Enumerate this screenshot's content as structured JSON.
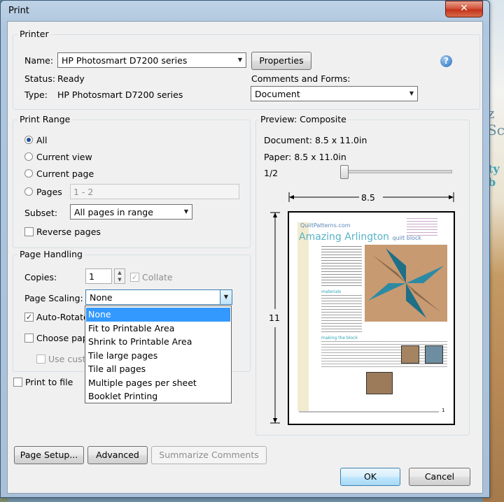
{
  "window": {
    "title": "Print",
    "close_glyph": "✕"
  },
  "printer": {
    "legend": "Printer",
    "name_label": "Name:",
    "name_value": "HP Photosmart D7200 series",
    "status_label": "Status:",
    "status_value": "Ready",
    "type_label": "Type:",
    "type_value": "HP Photosmart D7200 series",
    "properties_button": "Properties",
    "comments_label": "Comments and Forms:",
    "comments_value": "Document",
    "help_glyph": "?"
  },
  "print_range": {
    "legend": "Print Range",
    "options": [
      "All",
      "Current view",
      "Current page",
      "Pages"
    ],
    "selected": "All",
    "pages_value": "1 - 2",
    "subset_label": "Subset:",
    "subset_value": "All pages in range",
    "reverse_label": "Reverse pages",
    "reverse_checked": false
  },
  "page_handling": {
    "legend": "Page Handling",
    "copies_label": "Copies:",
    "copies_value": "1",
    "collate_label": "Collate",
    "collate_checked": true,
    "scaling_label": "Page Scaling:",
    "scaling_value": "None",
    "auto_rotate_label": "Auto-Rotate",
    "auto_rotate_checked": true,
    "choose_paper_label": "Choose pape",
    "use_custom_label": "Use custo",
    "scaling_options": [
      "None",
      "Fit to Printable Area",
      "Shrink to Printable Area",
      "Tile large pages",
      "Tile all pages",
      "Multiple pages per sheet",
      "Booklet Printing"
    ],
    "scaling_selected": "None"
  },
  "print_to_file_label": "Print to file",
  "preview": {
    "legend": "Preview: Composite",
    "document_label": "Document: 8.5 x 11.0in",
    "paper_label": "Paper: 8.5 x 11.0in",
    "page_indicator": "1/2",
    "width_dim": "8.5",
    "height_dim": "11",
    "page": {
      "site": "QuiltPatterns.com",
      "title_main": "Amazing Arlington",
      "title_sub": "quilt block",
      "section1": "materials",
      "section2": "making the block",
      "page_number": "1"
    }
  },
  "buttons": {
    "page_setup": "Page Setup...",
    "advanced": "Advanced",
    "summarize": "Summarize Comments",
    "ok": "OK",
    "cancel": "Cancel"
  },
  "background": {
    "text1": "z Sc",
    "text2": "ty b"
  }
}
